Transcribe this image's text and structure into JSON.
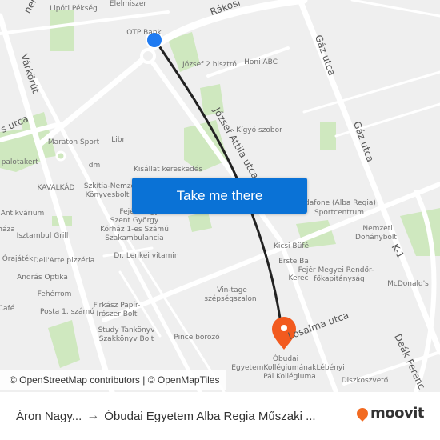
{
  "map": {
    "colors": {
      "background": "#efefef",
      "road": "#ffffff",
      "park": "#cfe8bf",
      "route": "#222222",
      "origin_marker": "#1f7bf2",
      "destination_marker": "#f25a1f",
      "button": "#0a72d6"
    },
    "street_labels": [
      {
        "text": "Rákosi"
      },
      {
        "text": "Gáz utca"
      },
      {
        "text": "Gáz utca"
      },
      {
        "text": "Várkörút"
      },
      {
        "text": "s utca"
      },
      {
        "text": "József Attila utca"
      },
      {
        "text": "Losalma utca"
      },
      {
        "text": "K-1"
      },
      {
        "text": "Deák Ferenc"
      },
      {
        "text": "ner"
      }
    ],
    "poi_labels": [
      {
        "text": "Lipóti Pékség"
      },
      {
        "text": "Élelmiszer"
      },
      {
        "text": "OTP Bank"
      },
      {
        "text": "József 2 bisztró"
      },
      {
        "text": "Honi ABC"
      },
      {
        "text": "Kígyó szobor"
      },
      {
        "text": "Maraton Sport"
      },
      {
        "text": "Libri"
      },
      {
        "text": "i palotakert"
      },
      {
        "text": "dm"
      },
      {
        "text": "Kisállat kereskedés"
      },
      {
        "text": "KAVALKÁD"
      },
      {
        "text": "Szkítia-Nemzeti"
      },
      {
        "text": "Könyvesbolt"
      },
      {
        "text": "Antikvárium"
      },
      {
        "text": "háza"
      },
      {
        "text": "Isztambul Grill"
      },
      {
        "text": "Fejér Megyei"
      },
      {
        "text": "Szent György"
      },
      {
        "text": "Kórház 1-es Számú"
      },
      {
        "text": "Szakambulancia"
      },
      {
        "text": "Órajáték"
      },
      {
        "text": "Dell'Arte pizzéria"
      },
      {
        "text": "Dr. Lenkei vitamin"
      },
      {
        "text": "András Optika"
      },
      {
        "text": "Fehérrom"
      },
      {
        "text": "Café"
      },
      {
        "text": "Posta 1. számú"
      },
      {
        "text": "Firkász Papír-"
      },
      {
        "text": "Írószer Bolt"
      },
      {
        "text": "Study Tankönyv"
      },
      {
        "text": "Szakkönyv Bolt"
      },
      {
        "text": "Pince borozó"
      },
      {
        "text": "Vin-tage"
      },
      {
        "text": "szépségszalon"
      },
      {
        "text": "Vodafone (Alba Regia)"
      },
      {
        "text": "Sportcentrum"
      },
      {
        "text": "Nemzeti"
      },
      {
        "text": "Dohánybolt"
      },
      {
        "text": "Kicsi Büfé"
      },
      {
        "text": "Erste Ba"
      },
      {
        "text": "Kerec"
      },
      {
        "text": "Fejér Megyei Rendőr-"
      },
      {
        "text": "főkapitányság"
      },
      {
        "text": "McDonald's"
      },
      {
        "text": "Óbudai"
      },
      {
        "text": "EgyetemKollégiumánakLébényi"
      },
      {
        "text": "Pál Kollégiuma"
      },
      {
        "text": "Diszkoszvető"
      }
    ],
    "cta_label": "Take me there",
    "attribution": "© OpenStreetMap contributors | © OpenMapTiles"
  },
  "footer": {
    "origin": "Áron Nagy...",
    "arrow": "→",
    "destination": "Óbudai Egyetem Alba Regia Műszaki ...",
    "brand": "moovit"
  }
}
